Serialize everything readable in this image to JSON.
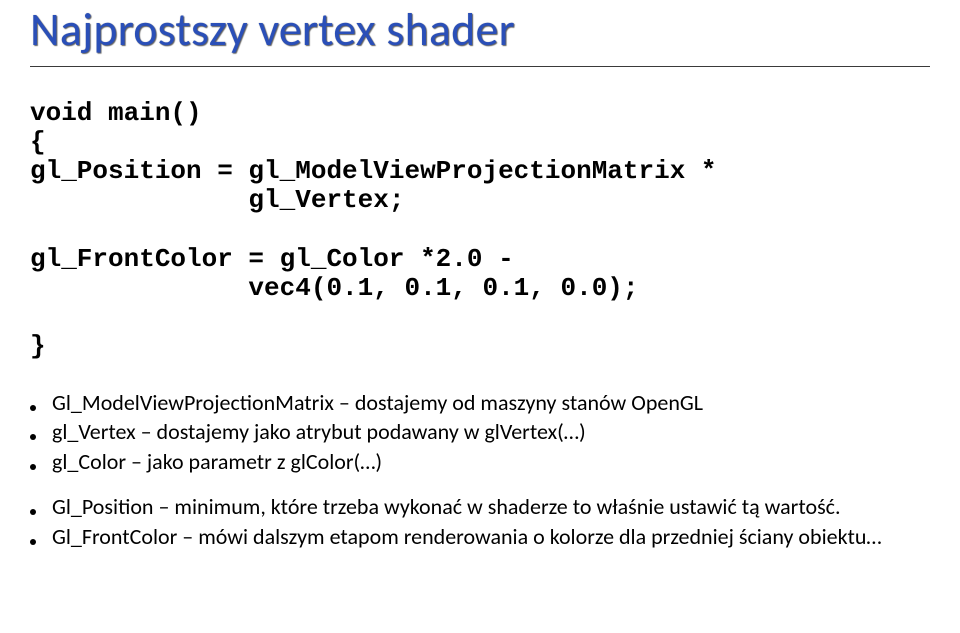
{
  "title": "Najprostszy vertex shader",
  "code": "void main()\n{\ngl_Position = gl_ModelViewProjectionMatrix *\n              gl_Vertex;\n\ngl_FrontColor = gl_Color *2.0 -\n              vec4(0.1, 0.1, 0.1, 0.0);\n\n}",
  "notes1": [
    "Gl_ModelViewProjectionMatrix – dostajemy od maszyny stanów OpenGL",
    "gl_Vertex – dostajemy jako atrybut podawany w glVertex(…)",
    "gl_Color – jako parametr z glColor(…)"
  ],
  "notes2": [
    "Gl_Position – minimum, które trzeba wykonać w shaderze to właśnie ustawić tą wartość.",
    "Gl_FrontColor – mówi dalszym etapom renderowania o kolorze dla przedniej ściany obiektu…"
  ]
}
